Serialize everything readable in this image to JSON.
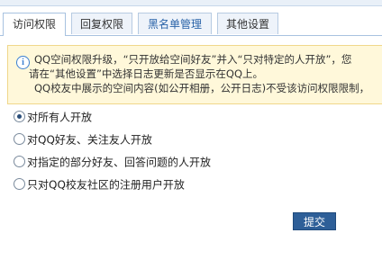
{
  "tabs": [
    {
      "label": "访问权限",
      "active": true
    },
    {
      "label": "回复权限",
      "active": false
    },
    {
      "label": "黑名单管理",
      "active": false
    },
    {
      "label": "其他设置",
      "active": false
    }
  ],
  "notice": {
    "icon": "info-icon",
    "line1": "QQ空间权限升级，“只开放给空间好友”并入“只对特定的人开放”，您",
    "line2": "请在“其他设置”中选择日志更新是否显示在QQ上。",
    "line3": "QQ校友中展示的空间内容(如公开相册，公开日志)不受该访问权限限制，"
  },
  "options": [
    {
      "label": "对所有人开放",
      "checked": true
    },
    {
      "label": "对QQ好友、关注友人开放",
      "checked": false
    },
    {
      "label": "对指定的部分好友、回答问题的人开放",
      "checked": false
    },
    {
      "label": "只对QQ校友社区的注册用户开放",
      "checked": false
    }
  ],
  "submit_label": "提交"
}
